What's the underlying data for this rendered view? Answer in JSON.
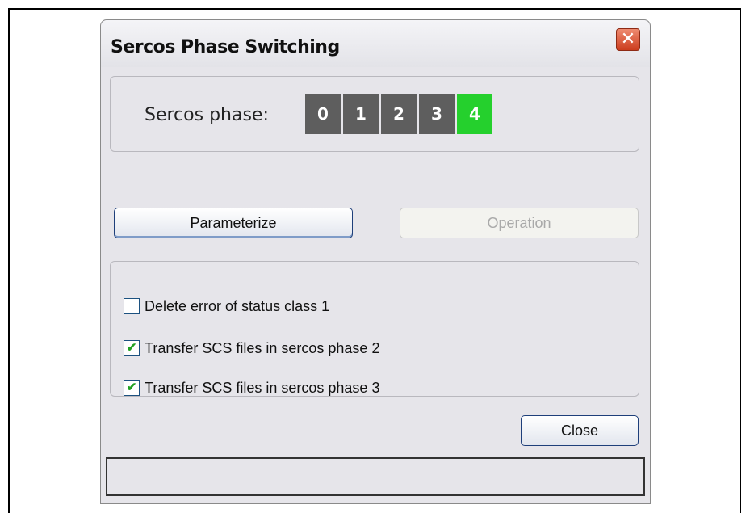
{
  "window": {
    "title": "Sercos Phase Switching",
    "close_glyph": "✕"
  },
  "phase": {
    "label": "Sercos phase:",
    "phases": [
      "0",
      "1",
      "2",
      "3",
      "4"
    ],
    "active": "4",
    "inactive_color": "#5e5e5e",
    "active_color": "#25d02d"
  },
  "buttons": {
    "parameterize": "Parameterize",
    "operation": "Operation",
    "close": "Close"
  },
  "options": [
    {
      "label": "Delete error of status class 1",
      "checked": false
    },
    {
      "label": "Transfer SCS files in sercos phase 2",
      "checked": true
    },
    {
      "label": "Transfer SCS files in sercos phase 3",
      "checked": true
    }
  ],
  "status_text": ""
}
